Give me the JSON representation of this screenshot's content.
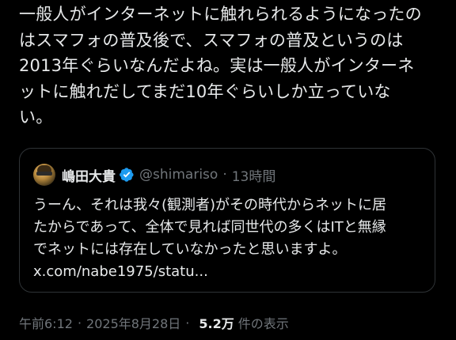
{
  "tweet": {
    "lines": [
      "一般人がインターネットに触れられるようになったの",
      "はスマフォの普及後で、スマフォの普及というのは",
      "2013年ぐらいなんだよね。実は一般人がインターネ",
      "ットに触れだしてまだ10年ぐらいしか立っていな",
      "い。"
    ]
  },
  "quote": {
    "display_name": "嶋田大貴",
    "handle": "@shimariso",
    "separator": "·",
    "time_ago": "13時間",
    "verified_icon": "verified-badge-icon",
    "verified_color": "#1d9bf0",
    "lines": [
      "うーん、それは我々(観測者)がその時代からネットに居",
      "たからであって、全体で見れば同世代の多くはITと無縁",
      "でネットには存在していなかったと思いますよ。",
      "x.com/nabe1975/statu..."
    ]
  },
  "meta": {
    "time": "午前6:12",
    "separator": "·",
    "date": "2025年8月28日",
    "separator2": "·",
    "views_count": "5.2万",
    "views_label": "件の表示"
  },
  "colors": {
    "background": "#000000",
    "text": "#e7e9ea",
    "secondary": "#71767b",
    "border": "#2f3336"
  }
}
